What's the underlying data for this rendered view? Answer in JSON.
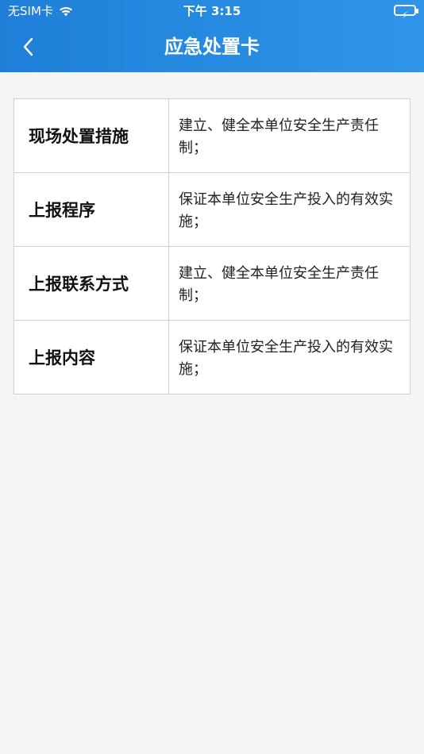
{
  "status": {
    "carrier": "无SIM卡",
    "time": "下午 3:15"
  },
  "nav": {
    "title": "应急处置卡"
  },
  "table": {
    "rows": [
      {
        "label": "现场处置措施",
        "value": "建立、健全本单位安全生产责任制；"
      },
      {
        "label": "上报程序",
        "value": "保证本单位安全生产投入的有效实施；"
      },
      {
        "label": "上报联系方式",
        "value": "建立、健全本单位安全生产责任制；"
      },
      {
        "label": "上报内容",
        "value": "保证本单位安全生产投入的有效实施；"
      }
    ]
  }
}
